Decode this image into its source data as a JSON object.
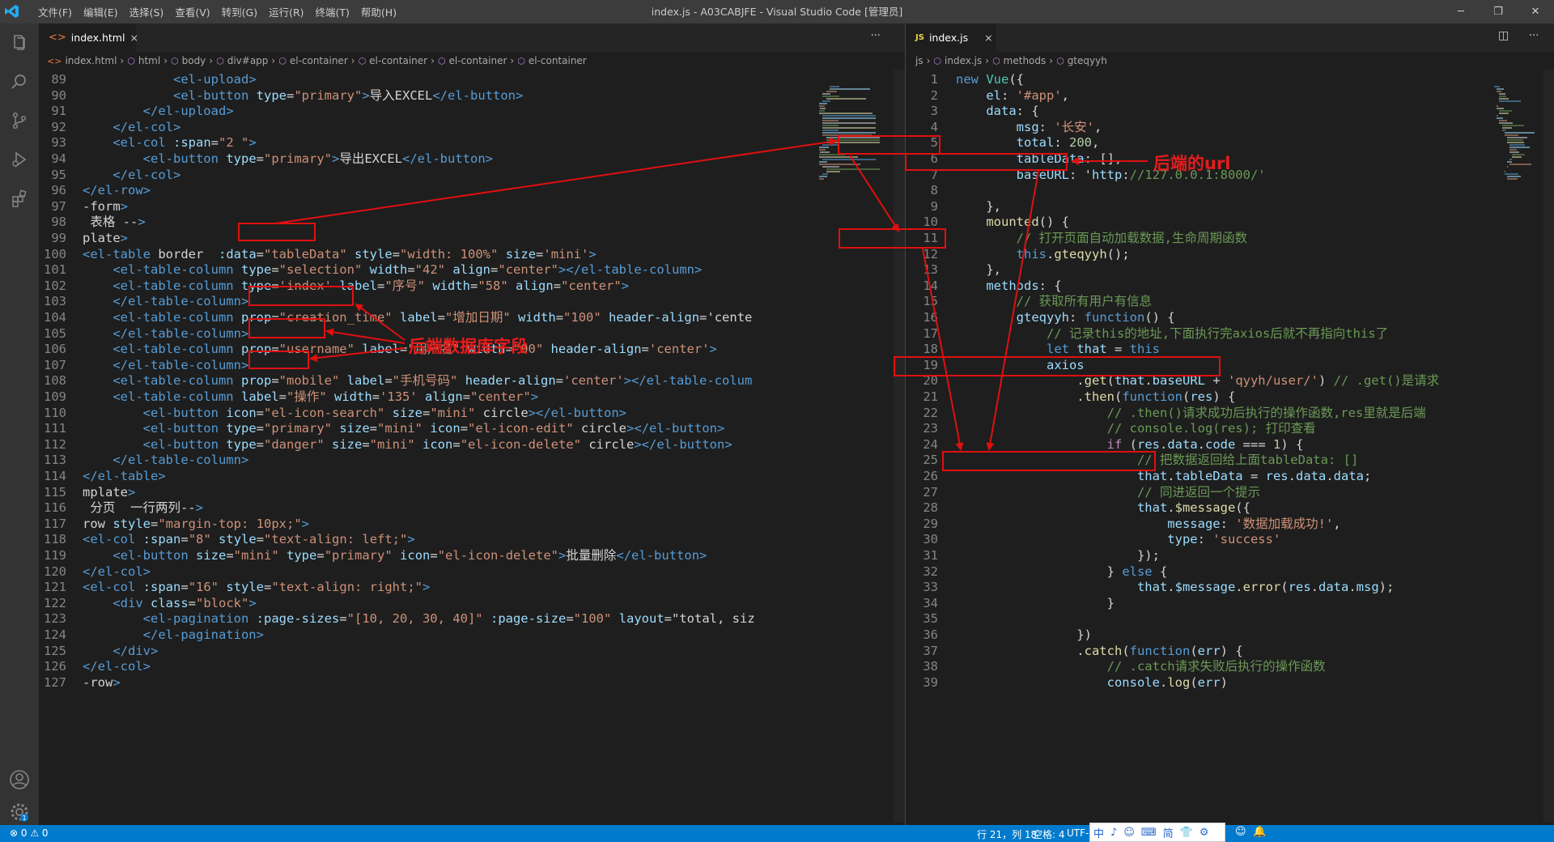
{
  "window": {
    "title": "index.js - A03CABJFE - Visual Studio Code [管理员]",
    "menu": [
      "文件(F)",
      "编辑(E)",
      "选择(S)",
      "查看(V)",
      "转到(G)",
      "运行(R)",
      "终端(T)",
      "帮助(H)"
    ]
  },
  "left_editor": {
    "tab_label": "index.html",
    "tab_close": "×",
    "more": "···",
    "breadcrumbs": [
      "index.html",
      "html",
      "body",
      "div#app",
      "el-container",
      "el-container",
      "el-container",
      "el-container"
    ],
    "lines": [
      {
        "n": "89",
        "t": "            <el-upload>"
      },
      {
        "n": "90",
        "t": "            <el-button type=\"primary\">导入EXCEL</el-button>"
      },
      {
        "n": "91",
        "t": "        </el-upload>"
      },
      {
        "n": "92",
        "t": "    </el-col>"
      },
      {
        "n": "93",
        "t": "    <el-col :span=\"2 \">"
      },
      {
        "n": "94",
        "t": "        <el-button type=\"primary\">导出EXCEL</el-button>"
      },
      {
        "n": "95",
        "t": "    </el-col>"
      },
      {
        "n": "96",
        "t": "</el-row>"
      },
      {
        "n": "97",
        "t": "-form>"
      },
      {
        "n": "98",
        "t": " 表格 -->"
      },
      {
        "n": "99",
        "t": "plate>"
      },
      {
        "n": "100",
        "t": "<el-table border  :data=\"tableData\" style=\"width: 100%\" size='mini'>"
      },
      {
        "n": "101",
        "t": "    <el-table-column type=\"selection\" width=\"42\" align=\"center\"></el-table-column>"
      },
      {
        "n": "102",
        "t": "    <el-table-column type='index' label=\"序号\" width=\"58\" align=\"center\">"
      },
      {
        "n": "103",
        "t": "    </el-table-column>"
      },
      {
        "n": "104",
        "t": "    <el-table-column prop=\"creation_time\" label=\"增加日期\" width=\"100\" header-align='cente"
      },
      {
        "n": "105",
        "t": "    </el-table-column>"
      },
      {
        "n": "106",
        "t": "    <el-table-column prop=\"username\" label=\"用户名\" width=\"90\" header-align='center'>"
      },
      {
        "n": "107",
        "t": "    </el-table-column>"
      },
      {
        "n": "108",
        "t": "    <el-table-column prop=\"mobile\" label=\"手机号码\" header-align='center'></el-table-colum"
      },
      {
        "n": "109",
        "t": "    <el-table-column label=\"操作\" width='135' align=\"center\">"
      },
      {
        "n": "110",
        "t": "        <el-button icon=\"el-icon-search\" size=\"mini\" circle></el-button>"
      },
      {
        "n": "111",
        "t": "        <el-button type=\"primary\" size=\"mini\" icon=\"el-icon-edit\" circle></el-button>"
      },
      {
        "n": "112",
        "t": "        <el-button type=\"danger\" size=\"mini\" icon=\"el-icon-delete\" circle></el-button>"
      },
      {
        "n": "113",
        "t": "    </el-table-column>"
      },
      {
        "n": "114",
        "t": "</el-table>"
      },
      {
        "n": "115",
        "t": "mplate>"
      },
      {
        "n": "116",
        "t": " 分页  一行两列-->"
      },
      {
        "n": "117",
        "t": "row style=\"margin-top: 10px;\">"
      },
      {
        "n": "118",
        "t": "<el-col :span=\"8\" style=\"text-align: left;\">"
      },
      {
        "n": "119",
        "t": "    <el-button size=\"mini\" type=\"primary\" icon=\"el-icon-delete\">批量删除</el-button>"
      },
      {
        "n": "120",
        "t": "</el-col>"
      },
      {
        "n": "121",
        "t": "<el-col :span=\"16\" style=\"text-align: right;\">"
      },
      {
        "n": "122",
        "t": "    <div class=\"block\">"
      },
      {
        "n": "123",
        "t": "        <el-pagination :page-sizes=\"[10, 20, 30, 40]\" :page-size=\"100\" layout=\"total, siz"
      },
      {
        "n": "124",
        "t": "        </el-pagination>"
      },
      {
        "n": "125",
        "t": "    </div>"
      },
      {
        "n": "126",
        "t": "</el-col>"
      },
      {
        "n": "127",
        "t": "-row>"
      }
    ]
  },
  "right_editor": {
    "tab_label": "index.js",
    "tab_icon": "JS",
    "tab_close": "×",
    "breadcrumbs": [
      "js",
      "index.js",
      "methods",
      "gteqyyh"
    ],
    "lines": [
      {
        "n": "1",
        "t": "new Vue({"
      },
      {
        "n": "2",
        "t": "    el: '#app',"
      },
      {
        "n": "3",
        "t": "    data: {"
      },
      {
        "n": "4",
        "t": "        msg: '长安',"
      },
      {
        "n": "5",
        "t": "        total: 200,"
      },
      {
        "n": "6",
        "t": "        tableData: [],"
      },
      {
        "n": "7",
        "t": "        baseURL: 'http://127.0.0.1:8000/'"
      },
      {
        "n": "8",
        "t": ""
      },
      {
        "n": "9",
        "t": "    },"
      },
      {
        "n": "10",
        "t": "    mounted() {"
      },
      {
        "n": "11",
        "t": "        // 打开页面自动加载数据,生命周期函数"
      },
      {
        "n": "12",
        "t": "        this.gteqyyh();"
      },
      {
        "n": "13",
        "t": "    },"
      },
      {
        "n": "14",
        "t": "    methods: {"
      },
      {
        "n": "15",
        "t": "        // 获取所有用户有信息"
      },
      {
        "n": "16",
        "t": "        gteqyyh: function() {"
      },
      {
        "n": "17",
        "t": "            // 记录this的地址,下面执行完axios后就不再指向this了"
      },
      {
        "n": "18",
        "t": "            let that = this"
      },
      {
        "n": "19",
        "t": "            axios"
      },
      {
        "n": "20",
        "t": "                .get(that.baseURL + 'qyyh/user/') // .get()是请求"
      },
      {
        "n": "21",
        "t": "                .then(function(res) {"
      },
      {
        "n": "22",
        "t": "                    // .then()请求成功后执行的操作函数,res里就是后端"
      },
      {
        "n": "23",
        "t": "                    // console.log(res); 打印查看"
      },
      {
        "n": "24",
        "t": "                    if (res.data.code === 1) {"
      },
      {
        "n": "25",
        "t": "                        // 把数据返回给上面tableData: []"
      },
      {
        "n": "26",
        "t": "                        that.tableData = res.data.data;"
      },
      {
        "n": "27",
        "t": "                        // 同进返回一个提示"
      },
      {
        "n": "28",
        "t": "                        that.$message({"
      },
      {
        "n": "29",
        "t": "                            message: '数据加载成功!',"
      },
      {
        "n": "30",
        "t": "                            type: 'success'"
      },
      {
        "n": "31",
        "t": "                        });"
      },
      {
        "n": "32",
        "t": "                    } else {"
      },
      {
        "n": "33",
        "t": "                        that.$message.error(res.data.msg);"
      },
      {
        "n": "34",
        "t": "                    }"
      },
      {
        "n": "35",
        "t": ""
      },
      {
        "n": "36",
        "t": "                })"
      },
      {
        "n": "37",
        "t": "                .catch(function(err) {"
      },
      {
        "n": "38",
        "t": "                    // .catch请求失败后执行的操作函数"
      },
      {
        "n": "39",
        "t": "                    console.log(err)"
      }
    ]
  },
  "annotations": {
    "backend_url": "后端的url",
    "backend_db_fields": "后端数据库字段"
  },
  "status": {
    "errors": "⊗ 0 ⚠ 0",
    "position": "行 21，列 18",
    "spaces": "空格: 4",
    "encoding": "UTF-8",
    "ime": [
      "中",
      "♪",
      "☺",
      "⌨",
      "简",
      "👕",
      "⚙"
    ]
  },
  "colors": {
    "accent": "#007acc",
    "annotation": "#e01010",
    "titlebar": "#3c3c3c",
    "activitybar": "#333333"
  }
}
